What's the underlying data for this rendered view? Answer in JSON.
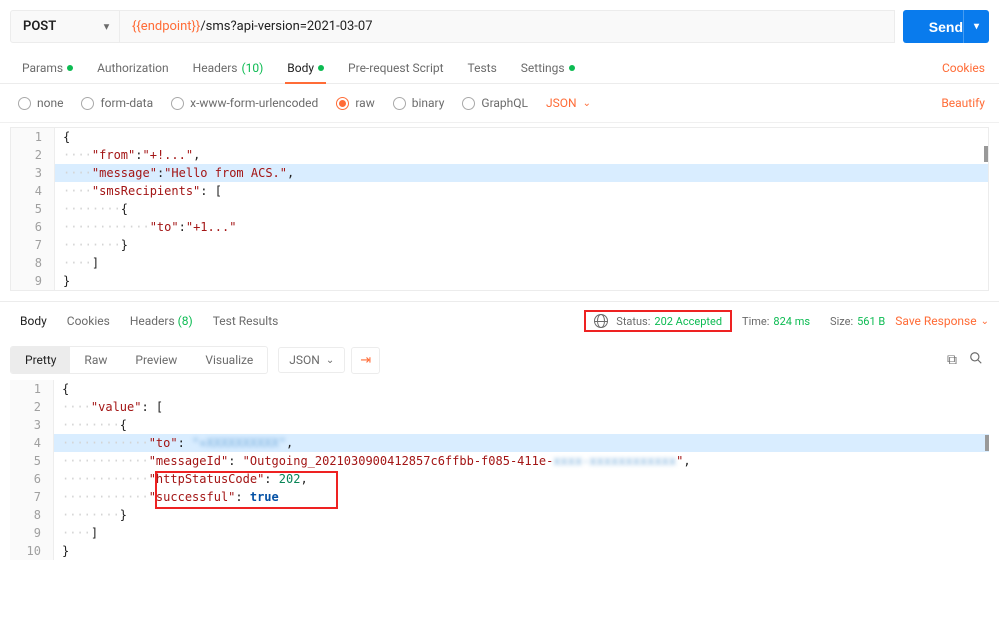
{
  "request": {
    "method": "POST",
    "url_var": "{{endpoint}}",
    "url_rest": "/sms?api-version=2021-03-07",
    "send_label": "Send"
  },
  "tabs": {
    "params": "Params",
    "auth": "Authorization",
    "headers": "Headers",
    "headers_count": "(10)",
    "body": "Body",
    "prerequest": "Pre-request Script",
    "tests": "Tests",
    "settings": "Settings",
    "cookies": "Cookies"
  },
  "body_types": {
    "none": "none",
    "formdata": "form-data",
    "xform": "x-www-form-urlencoded",
    "raw": "raw",
    "binary": "binary",
    "graphql": "GraphQL",
    "lang": "JSON",
    "beautify": "Beautify"
  },
  "req_body": {
    "l1": "{",
    "l2_key": "\"from\"",
    "l2_val": "\"+!...\"",
    "l3_key": "\"message\"",
    "l3_val": "\"Hello from ACS.\"",
    "l4_key": "\"smsRecipients\"",
    "l6_key": "\"to\"",
    "l6_val": "\"+1...\"",
    "l9": "}"
  },
  "resp_tabs": {
    "body": "Body",
    "cookies": "Cookies",
    "headers": "Headers",
    "headers_count": "(8)",
    "tests": "Test Results"
  },
  "status": {
    "label": "Status:",
    "value": "202 Accepted",
    "time_label": "Time:",
    "time_value": "824 ms",
    "size_label": "Size:",
    "size_value": "561 B",
    "save": "Save Response"
  },
  "view": {
    "pretty": "Pretty",
    "raw": "Raw",
    "preview": "Preview",
    "visualize": "Visualize",
    "fmt": "JSON"
  },
  "resp_body": {
    "l2_key": "\"value\"",
    "l4_key": "\"to\"",
    "l4_val": "\"+XXXXXXXXXX\"",
    "l5_key": "\"messageId\"",
    "l5_val_a": "\"Outgoing_2021030900412857c6ffbb-f085-411e-",
    "l5_val_b": "xxxx-xxxxxxxxxxxx",
    "l5_val_c": "\"",
    "l6_key": "\"httpStatusCode\"",
    "l6_val": "202",
    "l7_key": "\"successful\"",
    "l7_val": "true"
  },
  "chart_data": null
}
